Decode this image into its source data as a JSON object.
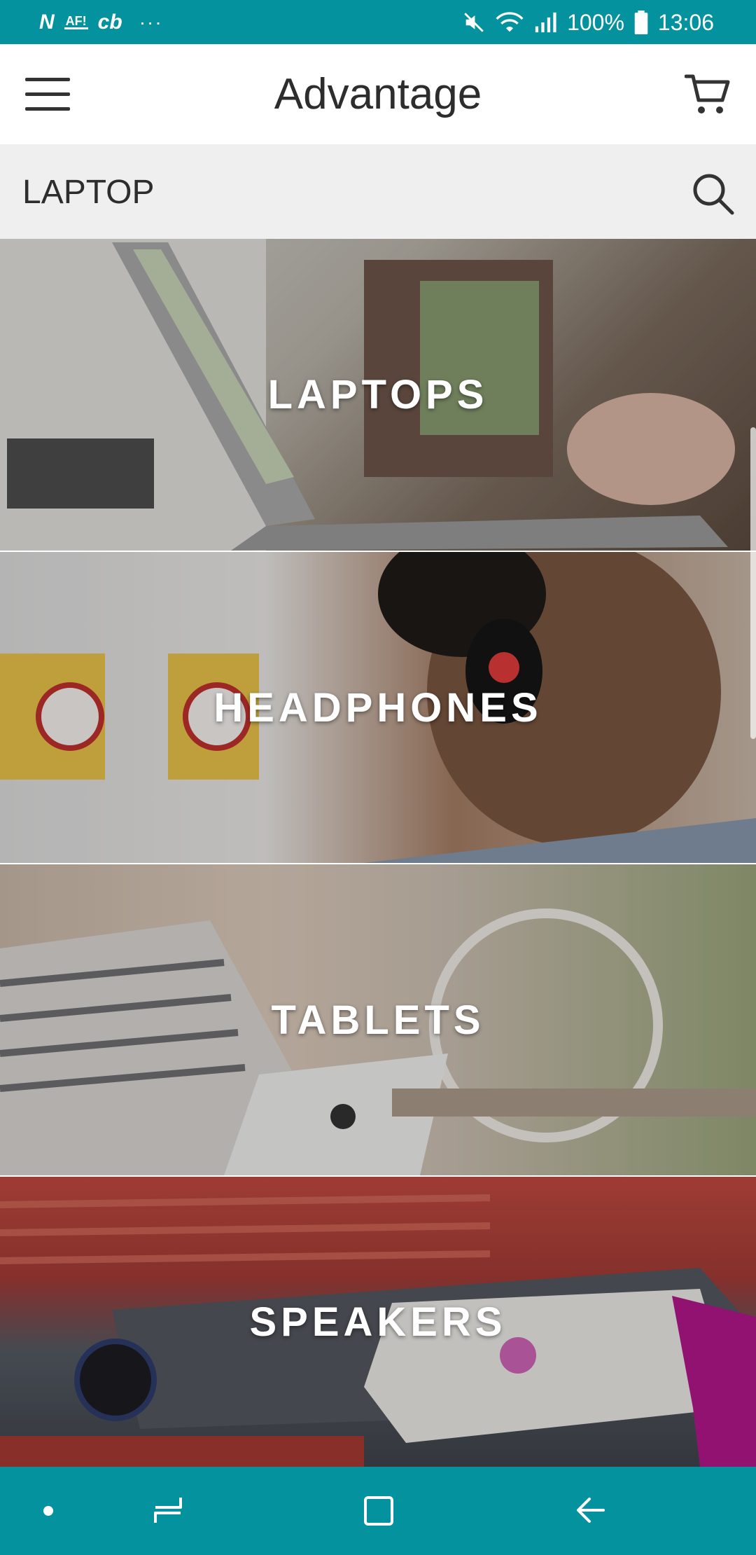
{
  "status_bar": {
    "icons_left": [
      "N",
      "AF!",
      "cb"
    ],
    "dots": "···",
    "battery": "100%",
    "time": "13:06",
    "icons_right": [
      "mute-icon",
      "wifi-icon",
      "signal-icon",
      "battery-icon"
    ]
  },
  "app_bar": {
    "title": "Advantage",
    "menu_icon": "hamburger-menu-icon",
    "cart_icon": "shopping-cart-icon"
  },
  "search": {
    "value": "LAPTOP",
    "icon": "search-icon"
  },
  "categories": [
    {
      "label": "LAPTOPS"
    },
    {
      "label": "HEADPHONES"
    },
    {
      "label": "TABLETS"
    },
    {
      "label": "SPEAKERS"
    }
  ],
  "nav_bar": {
    "icons": [
      "dot-icon",
      "recents-icon",
      "home-icon",
      "back-icon"
    ]
  },
  "colors": {
    "accent": "#04929f",
    "search_bg": "#efefef",
    "text": "#2d2d2d"
  }
}
